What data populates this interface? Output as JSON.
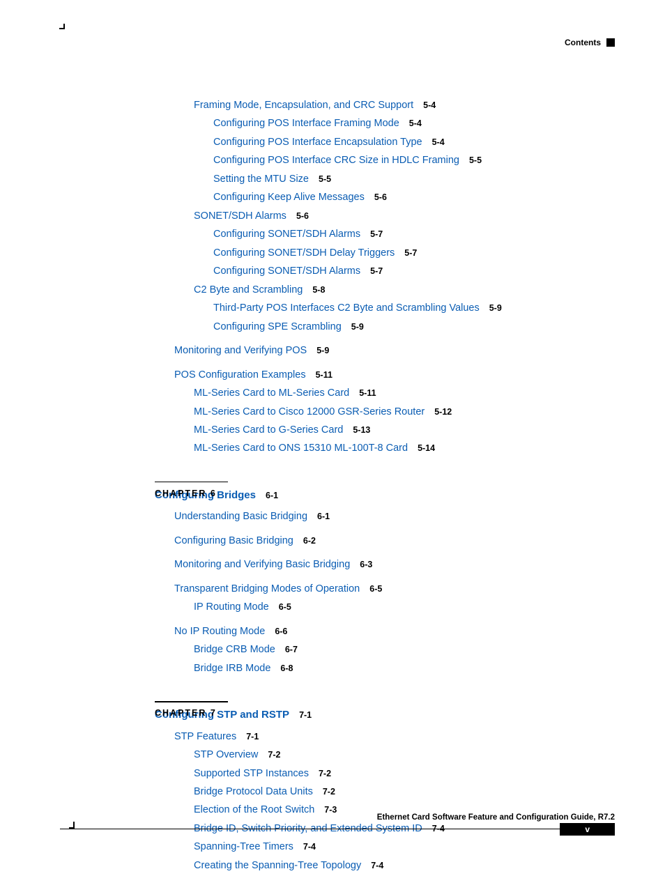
{
  "header": {
    "label": "Contents"
  },
  "footer": {
    "title": "Ethernet Card Software Feature and Configuration Guide, R7.2",
    "page": "v"
  },
  "chapter6": {
    "label": "CHAPTER",
    "num": "6",
    "title": "Configuring Bridges",
    "page": "6-1"
  },
  "chapter7": {
    "label": "CHAPTER",
    "num": "7",
    "title": "Configuring STP and RSTP",
    "page": "7-1"
  },
  "toc": [
    {
      "indent": 2,
      "text": "Framing Mode, Encapsulation, and CRC Support",
      "page": "5-4"
    },
    {
      "indent": 3,
      "text": "Configuring POS Interface Framing Mode",
      "page": "5-4"
    },
    {
      "indent": 3,
      "text": "Configuring POS Interface Encapsulation Type",
      "page": "5-4"
    },
    {
      "indent": 3,
      "text": "Configuring POS Interface CRC Size in HDLC Framing",
      "page": "5-5"
    },
    {
      "indent": 3,
      "text": "Setting the MTU Size",
      "page": "5-5"
    },
    {
      "indent": 3,
      "text": "Configuring Keep Alive Messages",
      "page": "5-6"
    },
    {
      "indent": 2,
      "text": "SONET/SDH Alarms",
      "page": "5-6"
    },
    {
      "indent": 3,
      "text": "Configuring SONET/SDH Alarms",
      "page": "5-7"
    },
    {
      "indent": 3,
      "text": "Configuring SONET/SDH Delay Triggers",
      "page": "5-7"
    },
    {
      "indent": 3,
      "text": "Configuring SONET/SDH Alarms",
      "page": "5-7"
    },
    {
      "indent": 2,
      "text": "C2 Byte and Scrambling",
      "page": "5-8"
    },
    {
      "indent": 3,
      "text": "Third-Party POS Interfaces C2 Byte and Scrambling Values",
      "page": "5-9"
    },
    {
      "indent": 3,
      "text": "Configuring SPE Scrambling",
      "page": "5-9"
    },
    {
      "gap": true
    },
    {
      "indent": 1,
      "text": "Monitoring and Verifying POS",
      "page": "5-9"
    },
    {
      "gap": true
    },
    {
      "indent": 1,
      "text": "POS Configuration Examples",
      "page": "5-11"
    },
    {
      "indent": 2,
      "text": "ML-Series Card to ML-Series Card",
      "page": "5-11"
    },
    {
      "indent": 2,
      "text": "ML-Series Card to Cisco 12000 GSR-Series Router",
      "page": "5-12"
    },
    {
      "indent": 2,
      "text": "ML-Series Card to G-Series Card",
      "page": "5-13"
    },
    {
      "indent": 2,
      "text": "ML-Series Card to ONS 15310 ML-100T-8 Card",
      "page": "5-14"
    },
    {
      "chapter": "chapter6"
    },
    {
      "gap": true
    },
    {
      "indent": 1,
      "text": "Understanding Basic Bridging",
      "page": "6-1"
    },
    {
      "gap": true
    },
    {
      "indent": 1,
      "text": "Configuring Basic Bridging",
      "page": "6-2"
    },
    {
      "gap": true
    },
    {
      "indent": 1,
      "text": "Monitoring and Verifying Basic Bridging",
      "page": "6-3"
    },
    {
      "gap": true
    },
    {
      "indent": 1,
      "text": "Transparent Bridging Modes of Operation",
      "page": "6-5"
    },
    {
      "indent": 2,
      "text": "IP Routing Mode",
      "page": "6-5"
    },
    {
      "gap": true
    },
    {
      "indent": 1,
      "text": "No IP Routing Mode",
      "page": "6-6"
    },
    {
      "indent": 2,
      "text": "Bridge CRB Mode",
      "page": "6-7"
    },
    {
      "indent": 2,
      "text": "Bridge IRB Mode",
      "page": "6-8"
    },
    {
      "chapter": "chapter7"
    },
    {
      "gap": true
    },
    {
      "indent": 1,
      "text": "STP Features",
      "page": "7-1"
    },
    {
      "indent": 2,
      "text": "STP Overview",
      "page": "7-2"
    },
    {
      "indent": 2,
      "text": "Supported STP Instances",
      "page": "7-2"
    },
    {
      "indent": 2,
      "text": "Bridge Protocol Data Units",
      "page": "7-2"
    },
    {
      "indent": 2,
      "text": "Election of the Root Switch",
      "page": "7-3"
    },
    {
      "indent": 2,
      "text": "Bridge ID, Switch Priority, and Extended System ID",
      "page": "7-4"
    },
    {
      "indent": 2,
      "text": "Spanning-Tree Timers",
      "page": "7-4"
    },
    {
      "indent": 2,
      "text": "Creating the Spanning-Tree Topology",
      "page": "7-4"
    }
  ]
}
